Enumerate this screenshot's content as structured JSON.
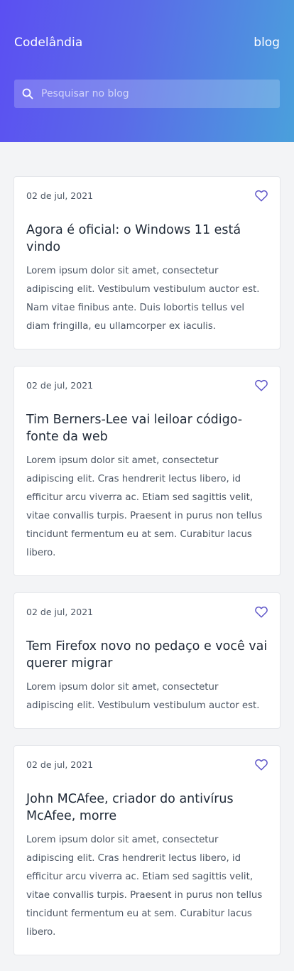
{
  "header": {
    "brand": "Codelândia",
    "nav_link": "blog",
    "search_placeholder": "Pesquisar no blog"
  },
  "posts": [
    {
      "date": "02 de jul, 2021",
      "title": "Agora é oficial: o Windows 11 está vindo",
      "excerpt": "Lorem ipsum dolor sit amet, consectetur adipiscing elit. Vestibulum vestibulum auctor est. Nam vitae finibus ante. Duis lobortis tellus vel diam fringilla, eu ullamcorper ex iaculis."
    },
    {
      "date": "02 de jul, 2021",
      "title": "Tim Berners-Lee vai leiloar código-fonte da web",
      "excerpt": "Lorem ipsum dolor sit amet, consectetur adipiscing elit. Cras hendrerit lectus libero, id efficitur arcu viverra ac. Etiam sed sagittis velit, vitae convallis turpis. Praesent in purus non tellus tincidunt fermentum eu at sem. Curabitur lacus libero."
    },
    {
      "date": "02 de jul, 2021",
      "title": "Tem Firefox novo no pedaço e você vai querer migrar",
      "excerpt": "Lorem ipsum dolor sit amet, consectetur adipiscing elit. Vestibulum vestibulum auctor est."
    },
    {
      "date": "02 de jul, 2021",
      "title": "John MCAfee, criador do antivírus McAfee, morre",
      "excerpt": "Lorem ipsum dolor sit amet, consectetur adipiscing elit. Cras hendrerit lectus libero, id efficitur arcu viverra ac. Etiam sed sagittis velit, vitae convallis turpis. Praesent in purus non tellus tincidunt fermentum eu at sem. Curabitur lacus libero."
    }
  ],
  "icons": {
    "search": "search-icon",
    "like": "heart-icon"
  },
  "colors": {
    "gradient_start": "#5b4ff2",
    "gradient_end": "#4aa0dc",
    "heart": "#5b52c7",
    "background": "#f3f4f6"
  }
}
